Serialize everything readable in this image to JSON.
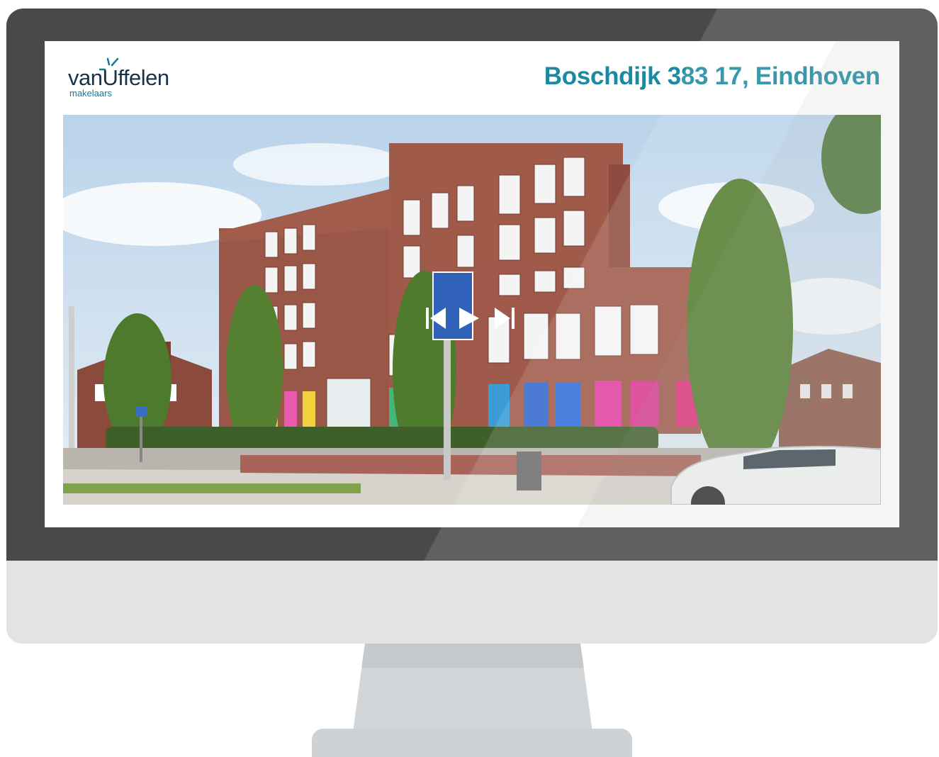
{
  "header": {
    "logo": {
      "word": "vanUffelen",
      "sub": "makelaars"
    },
    "title": "Boschdijk 383 17, Eindhoven"
  },
  "slider": {
    "controls": [
      "first-icon",
      "prev-icon",
      "next-icon",
      "last-icon"
    ]
  },
  "colors": {
    "bezel": "#4a4948",
    "chin": "#e1e3e5",
    "title": "#1b8aa0",
    "logo_text": "#17334a",
    "logo_accent": "#0e7e95"
  }
}
